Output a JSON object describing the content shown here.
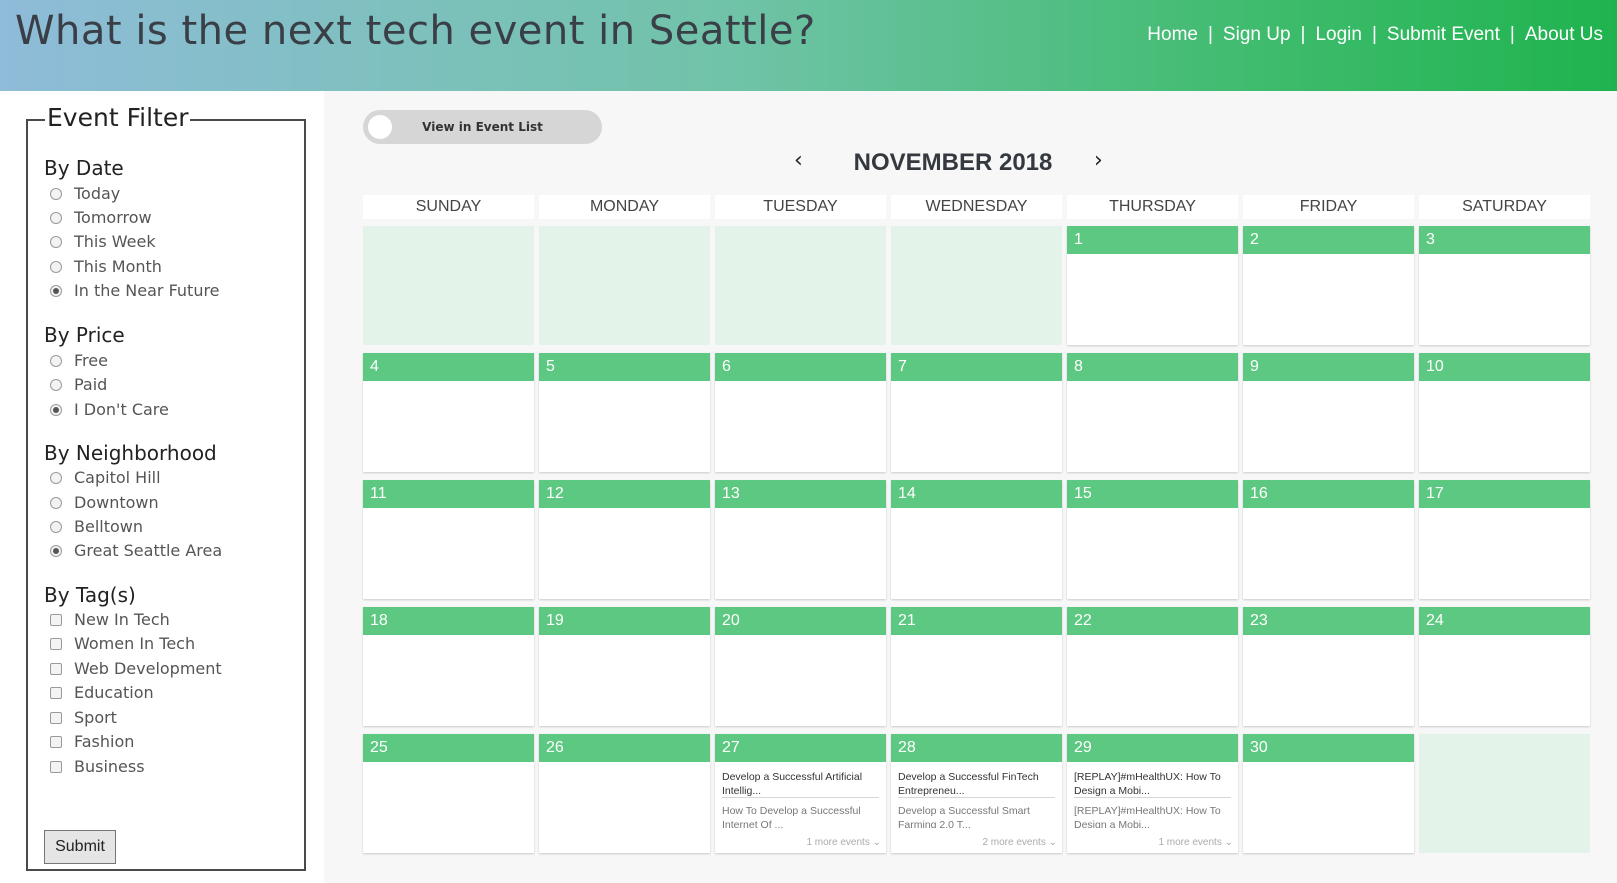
{
  "header": {
    "title": "What is the next tech event in Seattle?",
    "nav": [
      "Home",
      "Sign Up",
      "Login",
      "Submit Event",
      "About Us"
    ],
    "separator": "|"
  },
  "filter": {
    "title": "Event Filter",
    "by_date": {
      "title": "By Date",
      "options": [
        "Today",
        "Tomorrow",
        "This Week",
        "This Month",
        "In the Near Future"
      ],
      "selected": "In the Near Future"
    },
    "by_price": {
      "title": "By Price",
      "options": [
        "Free",
        "Paid",
        "I Don't Care"
      ],
      "selected": "I Don't Care"
    },
    "by_neighborhood": {
      "title": "By Neighborhood",
      "options": [
        "Capitol Hill",
        "Downtown",
        "Belltown",
        "Great Seattle Area"
      ],
      "selected": "Great Seattle Area"
    },
    "by_tags": {
      "title": "By Tag(s)",
      "options": [
        "New In Tech",
        "Women In Tech",
        "Web Development",
        "Education",
        "Sport",
        "Fashion",
        "Business"
      ]
    },
    "submit_label": "Submit"
  },
  "calendar": {
    "toggle_label": "View in Event List",
    "prev_icon": "‹",
    "next_icon": "›",
    "month_title": "NOVEMBER 2018",
    "weekdays": [
      "SUNDAY",
      "MONDAY",
      "TUESDAY",
      "WEDNESDAY",
      "THURSDAY",
      "FRIDAY",
      "SATURDAY"
    ],
    "leading_empty": 4,
    "days_in_month": 30,
    "trailing_empty": 1,
    "events": {
      "27": {
        "items": [
          "Develop a Successful Artificial Intellig...",
          "How To Develop a Successful Internet Of ..."
        ],
        "more": "1 more events"
      },
      "28": {
        "items": [
          "Develop a Successful FinTech Entrepreneu...",
          "Develop a Successful Smart Farming 2.0 T..."
        ],
        "more": "2 more events"
      },
      "29": {
        "items": [
          "[REPLAY]#mHealthUX: How To Design a Mobi...",
          "[REPLAY]#mHealthUX: How To Design a Mobi..."
        ],
        "more": "1 more events"
      }
    },
    "colors": {
      "day_header": "#5dc881",
      "empty_cell": "#e3f3e9"
    }
  }
}
